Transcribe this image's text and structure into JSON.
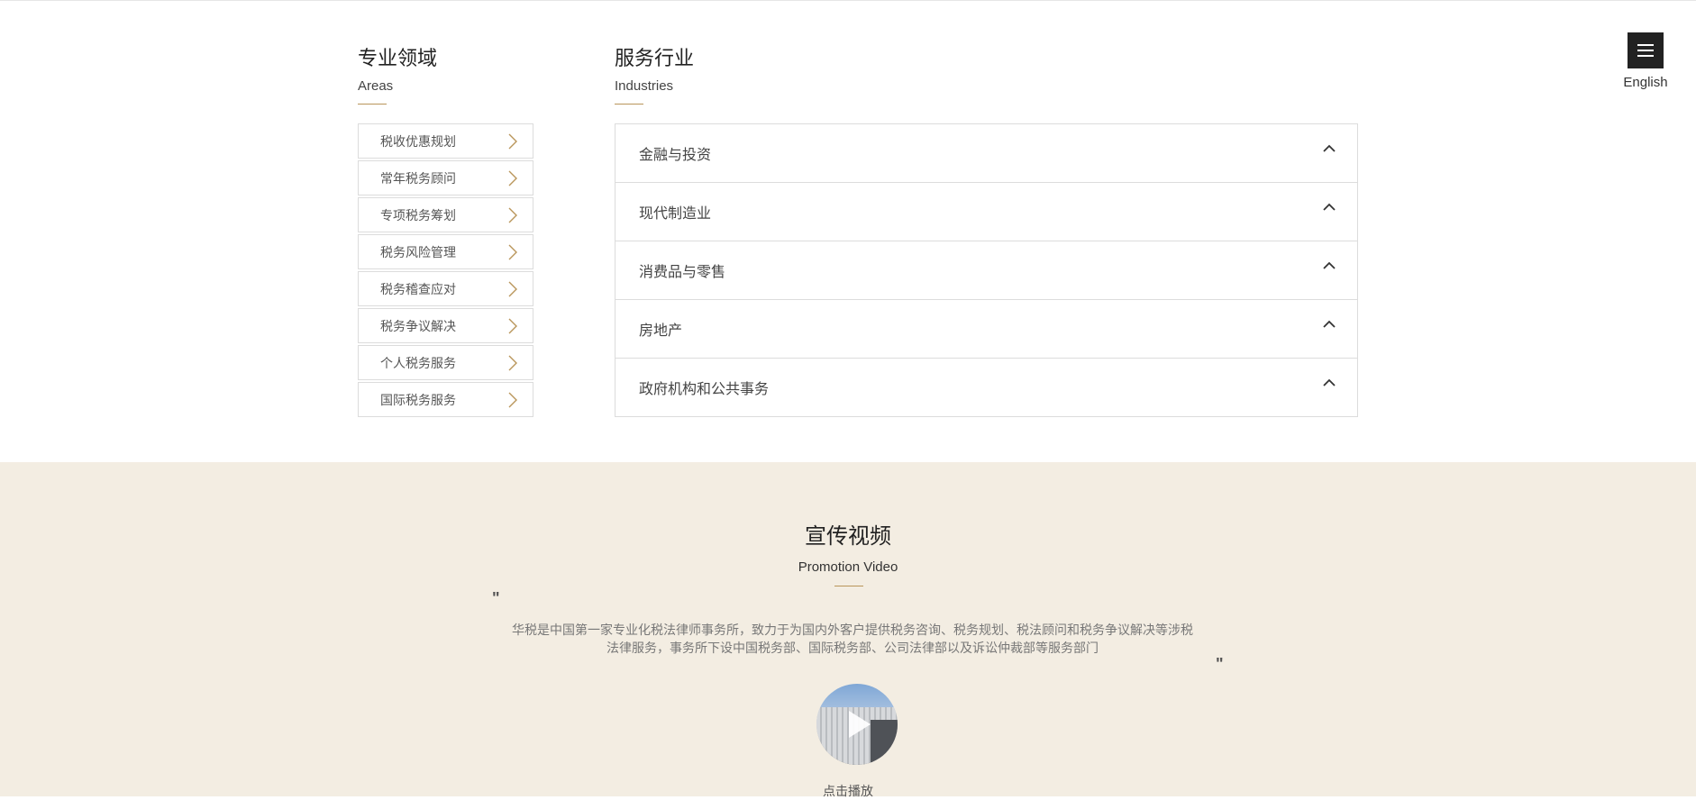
{
  "header": {
    "language_label": "English"
  },
  "areas": {
    "title_zh": "专业领域",
    "title_en": "Areas",
    "items": [
      {
        "label": "税收优惠规划"
      },
      {
        "label": "常年税务顾问"
      },
      {
        "label": "专项税务筹划"
      },
      {
        "label": "税务风险管理"
      },
      {
        "label": "税务稽查应对"
      },
      {
        "label": "税务争议解决"
      },
      {
        "label": "个人税务服务"
      },
      {
        "label": "国际税务服务"
      }
    ]
  },
  "industries": {
    "title_zh": "服务行业",
    "title_en": "Industries",
    "items": [
      {
        "label": "金融与投资"
      },
      {
        "label": "现代制造业"
      },
      {
        "label": "消费品与零售"
      },
      {
        "label": "房地产"
      },
      {
        "label": "政府机构和公共事务"
      }
    ]
  },
  "promo": {
    "title_zh": "宣传视频",
    "title_en": "Promotion Video",
    "quote_open": "\"",
    "quote_close": "\"",
    "description": "华税是中国第一家专业化税法律师事务所，致力于为国内外客户提供税务咨询、税务规划、税法顾问和税务争议解决等涉税法律服务，事务所下设中国税务部、国际税务部、公司法律部以及诉讼仲裁部等服务部门",
    "play_label": "点击播放"
  },
  "colors": {
    "accent_gold": "#b9955a",
    "section_bg": "#f3ede2",
    "menu_bg": "#222222"
  }
}
